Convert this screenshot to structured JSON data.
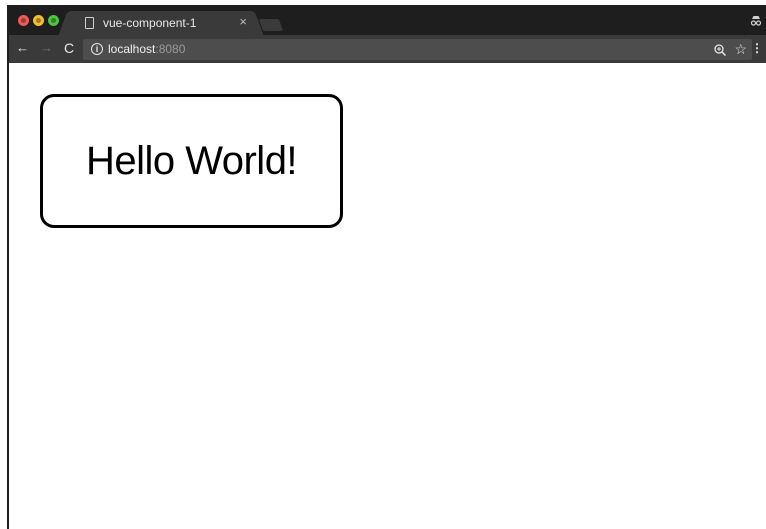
{
  "browser": {
    "traffic_lights": {
      "close_color": "#ee5b54",
      "minimize_color": "#f5bd32",
      "maximize_color": "#4fc43e"
    },
    "tab": {
      "title": "vue-component-1",
      "close_glyph": "×",
      "icon": "document-icon"
    },
    "toolbar": {
      "back_glyph": "←",
      "forward_glyph": "→",
      "reload_glyph": "C",
      "url_host": "localhost",
      "url_port": ":8080",
      "info_glyph": "i",
      "star_glyph": "☆",
      "menu_glyph": "⋮"
    }
  },
  "page": {
    "card_text": "Hello World!"
  }
}
